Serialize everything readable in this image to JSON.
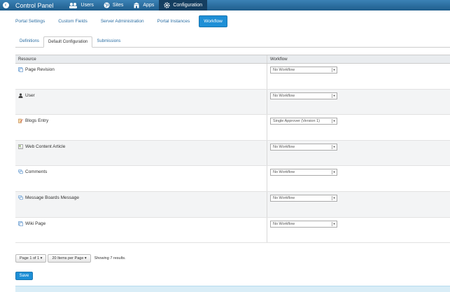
{
  "dock": {
    "title": "Control Panel",
    "items": [
      {
        "label": "Users",
        "icon": "users-icon"
      },
      {
        "label": "Sites",
        "icon": "globe-icon"
      },
      {
        "label": "Apps",
        "icon": "store-icon"
      },
      {
        "label": "Configuration",
        "icon": "gear-icon"
      }
    ]
  },
  "subnav": [
    "Portal Settings",
    "Custom Fields",
    "Server Administration",
    "Portal Instances",
    "Workflow"
  ],
  "tabs": [
    "Definitions",
    "Default Configuration",
    "Submissions"
  ],
  "table": {
    "headers": [
      "Resource",
      "Workflow"
    ],
    "rows": [
      {
        "resource": "Page Revision",
        "icon": "page-icon",
        "workflow": "No Workflow"
      },
      {
        "resource": "User",
        "icon": "user-icon",
        "workflow": "No Workflow"
      },
      {
        "resource": "Blogs Entry",
        "icon": "blog-icon",
        "workflow": "Single Approver (Version 1)"
      },
      {
        "resource": "Web Content Article",
        "icon": "article-icon",
        "workflow": "No Workflow"
      },
      {
        "resource": "Comments",
        "icon": "comments-icon",
        "workflow": "No Workflow"
      },
      {
        "resource": "Message Boards Message",
        "icon": "message-icon",
        "workflow": "No Workflow"
      },
      {
        "resource": "Wiki Page",
        "icon": "wiki-icon",
        "workflow": "No Workflow"
      }
    ]
  },
  "pager": {
    "page": "Page 1 of 1",
    "per_page": "20 Items per Page",
    "results": "Showing 7 results."
  },
  "save_label": "Save",
  "colors": {
    "dock": "#1f5d8c",
    "accent": "#1e8fd6",
    "link": "#2b6ea3"
  }
}
